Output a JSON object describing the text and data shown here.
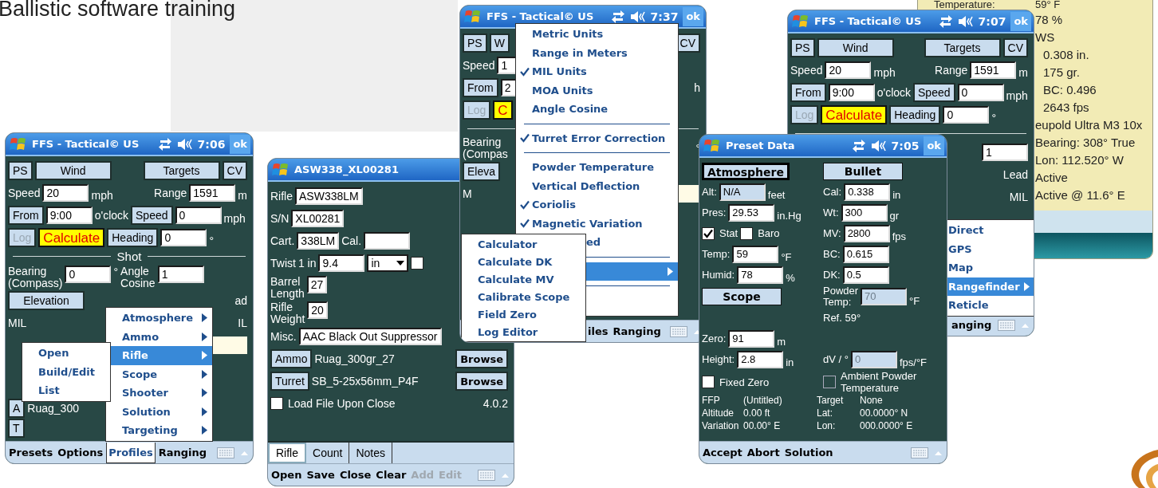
{
  "slide_title": "Ballistic software training",
  "windows": [
    {
      "title": "FFS - Tactical© US",
      "time": "7:06",
      "ok": "ok",
      "rows": [
        {
          "kind": "row",
          "left": [
            {
              "kind": "button",
              "label": "PS",
              "disabled": false
            },
            {
              "kind": "wide-button",
              "label": "Wind",
              "disabled": false
            }
          ],
          "right": [
            {
              "kind": "wide-button",
              "label": "Targets",
              "disabled": false
            },
            {
              "kind": "button",
              "label": "CV",
              "disabled": false
            }
          ]
        },
        {
          "kind": "row",
          "left": [
            {
              "kind": "label",
              "text": "Speed"
            },
            {
              "kind": "field",
              "value": "20",
              "disabled": false
            },
            {
              "kind": "unit",
              "text": "mph"
            }
          ],
          "right": [
            {
              "kind": "label",
              "text": "Range"
            },
            {
              "kind": "field",
              "value": "1591",
              "disabled": false
            },
            {
              "kind": "unit",
              "text": "m"
            }
          ]
        },
        {
          "kind": "row",
          "left": [
            {
              "kind": "button",
              "label": "From",
              "disabled": false
            },
            {
              "kind": "field",
              "value": "9:00",
              "disabled": false
            },
            {
              "kind": "label",
              "text": "o'clock"
            },
            {
              "kind": "button",
              "label": "Speed",
              "disabled": false
            },
            {
              "kind": "field",
              "value": "0",
              "disabled": false
            },
            {
              "kind": "unit",
              "text": "mph"
            }
          ]
        },
        {
          "kind": "row",
          "left": [
            {
              "kind": "button",
              "label": "Log",
              "disabled": true
            },
            {
              "kind": "highlight",
              "label": "Calculate",
              "disabled": false
            },
            {
              "kind": "button",
              "label": "Heading",
              "disabled": false
            },
            {
              "kind": "field",
              "value": "0",
              "disabled": false
            },
            {
              "kind": "unit",
              "text": "°"
            }
          ]
        },
        {
          "kind": "rule",
          "label": "Shot"
        },
        {
          "kind": "row",
          "left": [
            {
              "kind": "label2",
              "lines": [
                "Bearing",
                "(Compass)"
              ]
            },
            {
              "kind": "field",
              "value": "0",
              "disabled": false
            },
            {
              "kind": "unit",
              "text": "°"
            },
            {
              "kind": "label2",
              "lines": [
                "Angle",
                "Cosine"
              ]
            },
            {
              "kind": "field",
              "value": "1",
              "disabled": false
            }
          ]
        },
        {
          "kind": "row",
          "left": [
            {
              "kind": "wide-button",
              "label": "Elevation",
              "disabled": false
            }
          ],
          "right": [
            {
              "kind": "label",
              "text": "ad"
            }
          ]
        },
        {
          "kind": "row",
          "left": [
            {
              "kind": "label",
              "text": "MIL"
            }
          ],
          "right": [
            {
              "kind": "label",
              "text": "IL"
            }
          ]
        },
        {
          "kind": "row",
          "right": [
            {
              "kind": "output-field"
            }
          ]
        },
        {
          "kind": "row",
          "left": [
            {
              "kind": "button",
              "label": "A",
              "disabled": false
            },
            {
              "kind": "label",
              "text": "Ruag_300"
            }
          ]
        },
        {
          "kind": "row",
          "left": [
            {
              "kind": "button",
              "label": "T",
              "disabled": false
            }
          ]
        }
      ],
      "menus": [
        {
          "items": [
            {
              "kind": "item",
              "label": "Open",
              "selected": false,
              "submenu": false
            },
            {
              "kind": "item",
              "label": "Build/Edit",
              "selected": false,
              "submenu": false
            },
            {
              "kind": "item",
              "label": "List",
              "selected": false,
              "submenu": false
            }
          ]
        },
        {
          "items": [
            {
              "kind": "item",
              "label": "Atmosphere",
              "selected": false,
              "submenu": true
            },
            {
              "kind": "item",
              "label": "Ammo",
              "selected": false,
              "submenu": true
            },
            {
              "kind": "item",
              "label": "Rifle",
              "selected": true,
              "submenu": true
            },
            {
              "kind": "item",
              "label": "Scope",
              "selected": false,
              "submenu": true
            },
            {
              "kind": "item",
              "label": "Shooter",
              "selected": false,
              "submenu": true
            },
            {
              "kind": "item",
              "label": "Solution",
              "selected": false,
              "submenu": true
            },
            {
              "kind": "item",
              "label": "Targeting",
              "selected": false,
              "submenu": true
            }
          ]
        }
      ],
      "menubar": [
        {
          "label": "Presets",
          "selected": false,
          "disabled": false
        },
        {
          "label": "Options",
          "selected": false,
          "disabled": false
        },
        {
          "label": "Profiles",
          "selected": true,
          "disabled": false
        },
        {
          "label": "Ranging",
          "selected": false,
          "disabled": false
        }
      ]
    },
    {
      "title": "ASW338_XL00281",
      "rows": [
        {
          "kind": "row",
          "left": [
            {
              "kind": "label",
              "text": "Rifle"
            },
            {
              "kind": "wide-field",
              "value": "ASW338LM",
              "disabled": false
            }
          ]
        },
        {
          "kind": "row",
          "left": [
            {
              "kind": "label",
              "text": "S/N"
            },
            {
              "kind": "wide-field",
              "value": "XL00281",
              "disabled": false
            }
          ]
        },
        {
          "kind": "row",
          "left": [
            {
              "kind": "label",
              "text": "Cart."
            },
            {
              "kind": "wide-field",
              "value": "338LM",
              "disabled": false
            },
            {
              "kind": "label",
              "text": "Cal."
            },
            {
              "kind": "field",
              "disabled": false
            }
          ]
        },
        {
          "kind": "row",
          "left": [
            {
              "kind": "label",
              "text": "Twist"
            },
            {
              "kind": "label",
              "text": "1 in"
            },
            {
              "kind": "field",
              "value": "9.4",
              "disabled": false
            },
            {
              "kind": "select",
              "value": "in"
            },
            {
              "kind": "checkbox",
              "checked": false,
              "disabled": false
            }
          ]
        },
        {
          "kind": "row",
          "left": [
            {
              "kind": "label2",
              "lines": [
                "Barrel",
                "Length"
              ]
            },
            {
              "kind": "wide-field",
              "value": "27",
              "disabled": false
            }
          ]
        },
        {
          "kind": "row",
          "left": [
            {
              "kind": "label2",
              "lines": [
                "Rifle",
                "Weight"
              ]
            },
            {
              "kind": "wide-field",
              "value": "20",
              "disabled": false
            }
          ]
        },
        {
          "kind": "row",
          "left": [
            {
              "kind": "label",
              "text": "Misc."
            },
            {
              "kind": "wide-field",
              "value": "AAC Black Out Suppressor",
              "disabled": false
            }
          ]
        },
        {
          "kind": "row",
          "left": [
            {
              "kind": "button",
              "label": "Ammo",
              "disabled": false
            },
            {
              "kind": "label",
              "text": "Ruag_300gr_27"
            }
          ],
          "right": [
            {
              "kind": "bold-button",
              "label": "Browse",
              "disabled": false
            }
          ]
        },
        {
          "kind": "row",
          "left": [
            {
              "kind": "button",
              "label": "Turret",
              "disabled": false
            },
            {
              "kind": "label",
              "text": "SB_5-25x56mm_P4F"
            }
          ],
          "right": [
            {
              "kind": "bold-button",
              "label": "Browse",
              "disabled": false
            }
          ]
        },
        {
          "kind": "row",
          "left": [
            {
              "kind": "checkbox",
              "label": "Load File Upon Close",
              "checked": false,
              "disabled": false
            }
          ],
          "right": [
            {
              "kind": "label",
              "text": "4.0.2"
            }
          ]
        }
      ],
      "tabs": [
        {
          "label": "Rifle",
          "selected": true
        },
        {
          "label": "Count",
          "selected": false
        },
        {
          "label": "Notes",
          "selected": false
        }
      ],
      "menubar": [
        {
          "label": "Open",
          "selected": false,
          "disabled": false
        },
        {
          "label": "Save",
          "selected": false,
          "disabled": false
        },
        {
          "label": "Close",
          "selected": false,
          "disabled": false
        },
        {
          "label": "Clear",
          "selected": false,
          "disabled": false
        },
        {
          "label": "Add",
          "selected": false,
          "disabled": true
        },
        {
          "label": "Edit",
          "selected": false,
          "disabled": true
        }
      ]
    },
    {
      "title": "FFS - Tactical© US",
      "time": "7:37",
      "ok": "ok",
      "rows": [
        {
          "kind": "row",
          "left": [
            {
              "kind": "button",
              "label": "PS",
              "disabled": false
            },
            {
              "kind": "button",
              "label": "W",
              "disabled": false
            }
          ],
          "right": [
            {
              "kind": "button",
              "label": "CV",
              "disabled": false
            }
          ]
        },
        {
          "kind": "row",
          "left": [
            {
              "kind": "label",
              "text": "Speed"
            },
            {
              "kind": "field",
              "value": "1",
              "disabled": false
            }
          ]
        },
        {
          "kind": "row",
          "left": [
            {
              "kind": "button",
              "label": "From",
              "disabled": false
            },
            {
              "kind": "field",
              "value": "2",
              "disabled": false
            }
          ],
          "right": [
            {
              "kind": "unit",
              "text": "h"
            }
          ]
        },
        {
          "kind": "row",
          "left": [
            {
              "kind": "button",
              "label": "Log",
              "disabled": true
            },
            {
              "kind": "highlight",
              "label": "C",
              "disabled": false
            }
          ]
        },
        {
          "kind": "rule"
        },
        {
          "kind": "row",
          "left": [
            {
              "kind": "label2",
              "lines": [
                "Bearing",
                "(Compas"
              ]
            }
          ],
          "right": [
            {
              "kind": "unit",
              "text": "°"
            }
          ]
        },
        {
          "kind": "row",
          "left": [
            {
              "kind": "button",
              "label": "Eleva",
              "disabled": false
            }
          ]
        },
        {
          "kind": "row",
          "left": [
            {
              "kind": "label",
              "text": "M"
            }
          ],
          "right": [
            {
              "kind": "output-field"
            }
          ]
        }
      ],
      "menus": [
        {
          "items": [
            {
              "kind": "item",
              "label": "Calculator",
              "selected": false,
              "submenu": false
            },
            {
              "kind": "item",
              "label": "Calculate DK",
              "selected": false,
              "submenu": false
            },
            {
              "kind": "item",
              "label": "Calculate MV",
              "selected": false,
              "submenu": false
            },
            {
              "kind": "item",
              "label": "Calibrate Scope",
              "selected": false,
              "submenu": false
            },
            {
              "kind": "item",
              "label": "Field Zero",
              "selected": false,
              "submenu": false
            },
            {
              "kind": "item",
              "label": "Log Editor",
              "selected": false,
              "submenu": false
            }
          ]
        },
        {
          "items": [
            {
              "kind": "item",
              "label": "Metric Units",
              "checked": false,
              "selected": false,
              "submenu": false
            },
            {
              "kind": "item",
              "label": "Range in Meters",
              "checked": false,
              "selected": false,
              "submenu": false
            },
            {
              "kind": "item",
              "label": "MIL Units",
              "checked": true,
              "selected": false,
              "submenu": false
            },
            {
              "kind": "item",
              "label": "MOA Units",
              "checked": false,
              "selected": false,
              "submenu": false
            },
            {
              "kind": "item",
              "label": "Angle Cosine",
              "checked": false,
              "selected": false,
              "submenu": false
            },
            {
              "kind": "separator"
            },
            {
              "kind": "item",
              "label": "Turret Error Correction",
              "checked": true,
              "selected": false,
              "submenu": false
            },
            {
              "kind": "separator"
            },
            {
              "kind": "item",
              "label": "Powder Temperature",
              "checked": false,
              "selected": false,
              "submenu": false
            },
            {
              "kind": "item",
              "label": "Vertical Deflection",
              "checked": false,
              "selected": false,
              "submenu": false
            },
            {
              "kind": "item",
              "label": "Coriolis",
              "checked": true,
              "selected": false,
              "submenu": false
            },
            {
              "kind": "item",
              "label": "Magnetic Variation",
              "checked": true,
              "selected": false,
              "submenu": false
            },
            {
              "kind": "clipped",
              "label": "ed",
              "selected": false,
              "submenu": false
            },
            {
              "kind": "separator"
            },
            {
              "kind": "clipped",
              "selected": true,
              "submenu": true
            },
            {
              "kind": "separator"
            }
          ]
        }
      ],
      "menubar": [
        {
          "label": "iles",
          "selected": false,
          "disabled": false
        },
        {
          "label": "Ranging",
          "selected": false,
          "disabled": false
        }
      ]
    },
    {
      "title": "FFS - Tactical© US",
      "time": "7:07",
      "ok": "ok",
      "rows": [
        {
          "kind": "row",
          "left": [
            {
              "kind": "button",
              "label": "PS",
              "disabled": false
            },
            {
              "kind": "wide-button",
              "label": "Wind",
              "disabled": false
            }
          ],
          "right": [
            {
              "kind": "wide-button",
              "label": "Targets",
              "disabled": false
            },
            {
              "kind": "button",
              "label": "CV",
              "disabled": false
            }
          ]
        },
        {
          "kind": "row",
          "left": [
            {
              "kind": "label",
              "text": "Speed"
            },
            {
              "kind": "field",
              "value": "20",
              "disabled": false
            },
            {
              "kind": "unit",
              "text": "mph"
            }
          ],
          "right": [
            {
              "kind": "label",
              "text": "Range"
            },
            {
              "kind": "field",
              "value": "1591",
              "disabled": false
            },
            {
              "kind": "unit",
              "text": "m"
            }
          ]
        },
        {
          "kind": "row",
          "left": [
            {
              "kind": "button",
              "label": "From",
              "disabled": false
            },
            {
              "kind": "field",
              "value": "9:00",
              "disabled": false
            },
            {
              "kind": "label",
              "text": "o'clock"
            },
            {
              "kind": "button",
              "label": "Speed",
              "disabled": false
            },
            {
              "kind": "field",
              "value": "0",
              "disabled": false
            },
            {
              "kind": "unit",
              "text": "mph"
            }
          ]
        },
        {
          "kind": "row",
          "left": [
            {
              "kind": "button",
              "label": "Log",
              "disabled": true
            },
            {
              "kind": "highlight",
              "label": "Calculate",
              "disabled": false
            },
            {
              "kind": "button",
              "label": "Heading",
              "disabled": false
            },
            {
              "kind": "field",
              "value": "0",
              "disabled": false
            },
            {
              "kind": "unit",
              "text": "°"
            }
          ]
        },
        {
          "kind": "rule"
        },
        {
          "kind": "row",
          "right": [
            {
              "kind": "field",
              "value": "1",
              "disabled": false
            }
          ]
        },
        {
          "kind": "row",
          "right": [
            {
              "kind": "label",
              "text": "Lead"
            }
          ]
        },
        {
          "kind": "row",
          "right": [
            {
              "kind": "label",
              "text": "MIL"
            }
          ]
        }
      ],
      "menus": [
        {
          "items": [
            {
              "kind": "item",
              "label": "Direct",
              "selected": false,
              "submenu": false
            },
            {
              "kind": "item",
              "label": "GPS",
              "selected": false,
              "submenu": false
            },
            {
              "kind": "item",
              "label": "Map",
              "selected": false,
              "submenu": false
            },
            {
              "kind": "item",
              "label": "Rangefinder",
              "selected": true,
              "submenu": true
            },
            {
              "kind": "item",
              "label": "Reticle",
              "selected": false,
              "submenu": false
            }
          ]
        }
      ],
      "menubar": [
        {
          "label": "anging",
          "selected": false,
          "disabled": false
        }
      ]
    },
    {
      "title": "Preset Data",
      "time": "7:05",
      "ok": "ok",
      "rows": [
        {
          "kind": "row",
          "left": [
            {
              "kind": "heading",
              "label": "Atmosphere",
              "focused": true
            }
          ],
          "right": [
            {
              "kind": "heading",
              "label": "Bullet",
              "focused": false
            }
          ]
        },
        {
          "kind": "row",
          "left": [
            {
              "kind": "label",
              "text": "Alt:"
            },
            {
              "kind": "readonly-field",
              "value": "N/A"
            },
            {
              "kind": "unit",
              "text": "feet"
            }
          ],
          "right": [
            {
              "kind": "label",
              "text": "Cal:"
            },
            {
              "kind": "field",
              "value": "0.338",
              "disabled": false
            },
            {
              "kind": "unit",
              "text": "in"
            }
          ]
        },
        {
          "kind": "row",
          "left": [
            {
              "kind": "label",
              "text": "Pres:"
            },
            {
              "kind": "field",
              "value": "29.53",
              "disabled": false
            },
            {
              "kind": "unit",
              "text": "in.Hg"
            }
          ],
          "right": [
            {
              "kind": "label",
              "text": "Wt:"
            },
            {
              "kind": "field",
              "value": "300",
              "disabled": false
            },
            {
              "kind": "unit",
              "text": "gr"
            }
          ]
        },
        {
          "kind": "row",
          "left": [
            {
              "kind": "checkbox",
              "label": "Stat",
              "checked": true,
              "disabled": false
            },
            {
              "kind": "checkbox",
              "label": "Baro",
              "checked": false,
              "disabled": false
            }
          ],
          "right": [
            {
              "kind": "label",
              "text": "MV:"
            },
            {
              "kind": "field",
              "value": "2800",
              "disabled": false
            },
            {
              "kind": "unit",
              "text": "fps"
            }
          ]
        },
        {
          "kind": "row",
          "left": [
            {
              "kind": "label",
              "text": "Temp:"
            },
            {
              "kind": "field",
              "value": "59",
              "disabled": false
            },
            {
              "kind": "unit",
              "text": "°F"
            }
          ],
          "right": [
            {
              "kind": "label",
              "text": "BC:"
            },
            {
              "kind": "field",
              "value": "0.615",
              "disabled": false
            }
          ]
        },
        {
          "kind": "row",
          "left": [
            {
              "kind": "label",
              "text": "Humid:"
            },
            {
              "kind": "field",
              "value": "78",
              "disabled": false
            },
            {
              "kind": "unit",
              "text": "%"
            }
          ],
          "right": [
            {
              "kind": "label",
              "text": "DK:"
            },
            {
              "kind": "field",
              "value": "0.5",
              "disabled": false
            }
          ]
        },
        {
          "kind": "row",
          "left": [
            {
              "kind": "heading",
              "label": "Scope",
              "focused": false
            }
          ],
          "right": [
            {
              "kind": "label2",
              "lines": [
                "Powder",
                "Temp:"
              ]
            },
            {
              "kind": "field",
              "value": "70",
              "disabled": true
            },
            {
              "kind": "unit",
              "text": "°F"
            }
          ]
        },
        {
          "kind": "row",
          "right": [
            {
              "kind": "label",
              "text": "Ref.  59°"
            }
          ]
        },
        {
          "kind": "row",
          "left": [
            {
              "kind": "label",
              "text": "Zero:"
            },
            {
              "kind": "field",
              "value": "91",
              "disabled": false
            },
            {
              "kind": "unit",
              "text": "m"
            }
          ]
        },
        {
          "kind": "row",
          "left": [
            {
              "kind": "label",
              "text": "Height:"
            },
            {
              "kind": "field",
              "value": "2.8",
              "disabled": false
            },
            {
              "kind": "unit",
              "text": "in"
            }
          ],
          "right": [
            {
              "kind": "label",
              "text": "dV / °"
            },
            {
              "kind": "field",
              "value": "0",
              "disabled": true
            },
            {
              "kind": "unit",
              "text": "fps/°F"
            }
          ]
        },
        {
          "kind": "row",
          "left": [
            {
              "kind": "checkbox",
              "label": "Fixed Zero",
              "checked": false,
              "disabled": false
            }
          ],
          "right": [
            {
              "kind": "checkbox",
              "label": "Ambient Powder Temperature",
              "checked": false,
              "disabled": true
            }
          ]
        },
        {
          "kind": "info",
          "cells": [
            "FFP",
            "(Untitled)",
            "Target",
            "None"
          ]
        },
        {
          "kind": "info",
          "cells": [
            "Altitude",
            "0.00 ft",
            "Lat:",
            "00.0000° N"
          ]
        },
        {
          "kind": "info",
          "cells": [
            "Variation",
            "00.00° E",
            "Lon:",
            "000.0000° E"
          ]
        }
      ],
      "menubar": [
        {
          "label": "Accept",
          "selected": false,
          "disabled": false
        },
        {
          "label": "Abort",
          "selected": false,
          "disabled": false
        },
        {
          "label": "Solution",
          "selected": false,
          "disabled": false
        }
      ]
    }
  ],
  "info_panel": {
    "lines": [
      {
        "kind": "pair",
        "label": "Temperature:",
        "value": "59° F"
      },
      {
        "kind": "line",
        "text": "78 %"
      },
      {
        "kind": "line",
        "text": "WS"
      },
      {
        "kind": "indented",
        "text": "0.308 in."
      },
      {
        "kind": "indented",
        "text": "175 gr."
      },
      {
        "kind": "indented",
        "text": "BC:  0.496"
      },
      {
        "kind": "indented",
        "text": "2643 fps"
      },
      {
        "kind": "line",
        "text": "eupold Ultra M3 10x"
      },
      {
        "kind": "line",
        "text": "Bearing: 308° True"
      },
      {
        "kind": "line",
        "text": "Lon: 112.520° W"
      },
      {
        "kind": "line",
        "text": "Active"
      },
      {
        "kind": "line",
        "text": "Active @ 11.6° E"
      }
    ]
  }
}
